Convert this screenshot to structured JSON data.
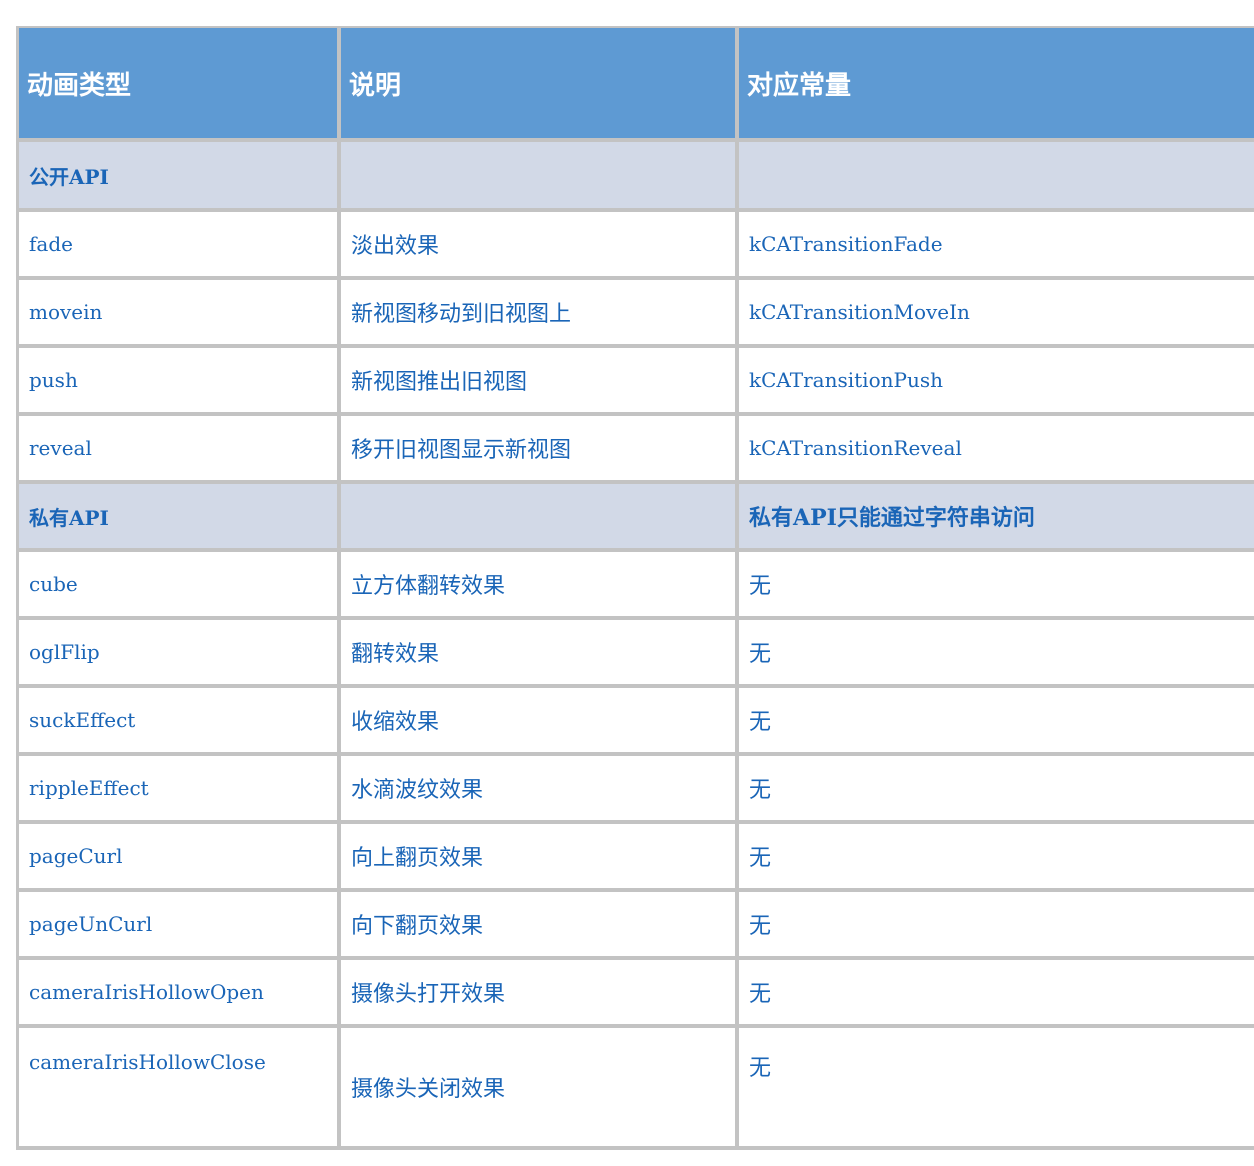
{
  "table": {
    "headers": [
      "动画类型",
      "说明",
      "对应常量"
    ],
    "rows": [
      {
        "type": "section",
        "cells": [
          "公开API",
          "",
          ""
        ]
      },
      {
        "type": "data",
        "cells": [
          "fade",
          "淡出效果",
          "kCATransitionFade"
        ]
      },
      {
        "type": "data",
        "cells": [
          "movein",
          "新视图移动到旧视图上",
          "kCATransitionMoveIn"
        ]
      },
      {
        "type": "data",
        "cells": [
          "push",
          "新视图推出旧视图",
          "kCATransitionPush"
        ]
      },
      {
        "type": "data",
        "cells": [
          "reveal",
          "移开旧视图显示新视图",
          "kCATransitionReveal"
        ]
      },
      {
        "type": "section",
        "cells": [
          "私有API",
          "",
          "私有API只能通过字符串访问"
        ]
      },
      {
        "type": "data",
        "cells": [
          "cube",
          "立方体翻转效果",
          "无"
        ]
      },
      {
        "type": "data",
        "cells": [
          "oglFlip",
          "翻转效果",
          "无"
        ]
      },
      {
        "type": "data",
        "cells": [
          "suckEffect",
          "收缩效果",
          "无"
        ]
      },
      {
        "type": "data",
        "cells": [
          "rippleEffect",
          "水滴波纹效果",
          "无"
        ]
      },
      {
        "type": "data",
        "cells": [
          "pageCurl",
          "向上翻页效果",
          "无"
        ]
      },
      {
        "type": "data",
        "cells": [
          "pageUnCurl",
          "向下翻页效果",
          "无"
        ]
      },
      {
        "type": "data",
        "cells": [
          "cameraIrisHollowOpen",
          "摄像头打开效果",
          "无"
        ]
      },
      {
        "type": "data",
        "cells": [
          "cameraIrisHollowClose",
          "摄像头关闭效果",
          "无"
        ]
      }
    ]
  },
  "colors": {
    "header_bg": "#5e9ad3",
    "header_text": "#ffffff",
    "section_bg": "#d2d9e7",
    "cell_text": "#1a65b7",
    "border": "#c3c3c3"
  }
}
